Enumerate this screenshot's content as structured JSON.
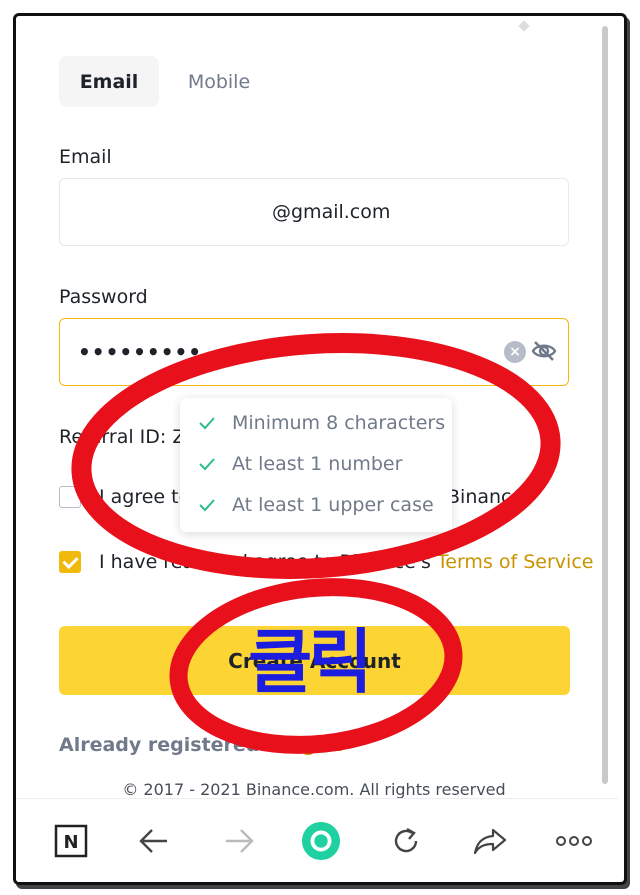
{
  "tabs": [
    {
      "label": "Email",
      "active": true
    },
    {
      "label": "Mobile",
      "active": false
    }
  ],
  "email": {
    "label": "Email",
    "value": "@gmail.com"
  },
  "password": {
    "label": "Password",
    "value": "•••••••••"
  },
  "password_requirements": [
    {
      "text": "Minimum 8 characters",
      "met": true
    },
    {
      "text": "At least 1 number",
      "met": true
    },
    {
      "text": "At least 1 upper case",
      "met": true
    }
  ],
  "referral": {
    "label": "Referral ID: Z"
  },
  "agreement_1": {
    "left_text": "I agree to",
    "right_text": "Binance",
    "checked": false
  },
  "agreement_2": {
    "prefix": "I have read and agree to Binance's",
    "link_text": "Terms of Service",
    "checked": true
  },
  "create_button": {
    "label": "Create Account"
  },
  "login_prompt": {
    "text": "Already registered?",
    "link": "Log In"
  },
  "copyright": "© 2017 - 2021 Binance.com. All rights reserved",
  "annotation": {
    "korean_label": "클릭",
    "circle_color": "#e8101a",
    "text_color": "#1d1de0"
  },
  "colors": {
    "accent": "#f0b90b",
    "button": "#fcd535",
    "link": "#c99400",
    "check_green": "#2ebd85"
  },
  "browser_nav": {
    "icons": [
      "notion-icon",
      "back-arrow-icon",
      "forward-arrow-icon",
      "home-circle-icon",
      "reload-icon",
      "share-icon",
      "more-icon"
    ]
  }
}
